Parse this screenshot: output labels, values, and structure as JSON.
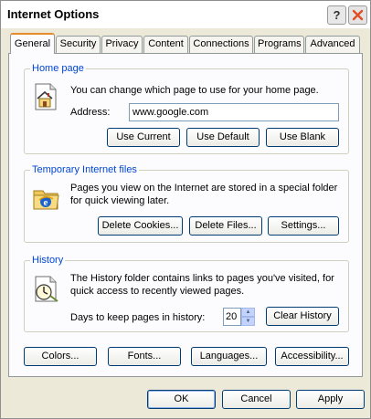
{
  "window": {
    "title": "Internet Options",
    "help_label": "?",
    "close_label": "✕"
  },
  "tabs": [
    {
      "label": "General",
      "active": true
    },
    {
      "label": "Security"
    },
    {
      "label": "Privacy"
    },
    {
      "label": "Content"
    },
    {
      "label": "Connections"
    },
    {
      "label": "Programs"
    },
    {
      "label": "Advanced"
    }
  ],
  "home_page": {
    "title": "Home page",
    "icon": "house-page-icon",
    "description": "You can change which page to use for your home page.",
    "address_label": "Address:",
    "address_value": "www.google.com",
    "buttons": [
      "Use Current",
      "Use Default",
      "Use Blank"
    ]
  },
  "temp_files": {
    "title": "Temporary Internet files",
    "icon": "ie-folder-icon",
    "description_line1": "Pages you view on the Internet are stored in a special folder",
    "description_line2": "for quick viewing later.",
    "buttons": [
      "Delete Cookies...",
      "Delete Files...",
      "Settings..."
    ]
  },
  "history": {
    "title": "History",
    "icon": "history-clock-icon",
    "description_line1": "The History folder contains links to pages you've visited, for",
    "description_line2": "quick access to recently viewed pages.",
    "days_label": "Days to keep pages in history:",
    "days_value": "20",
    "clear_button": "Clear History"
  },
  "bottom_buttons": [
    "Colors...",
    "Fonts...",
    "Languages...",
    "Accessibility..."
  ],
  "dialog_buttons": [
    "OK",
    "Cancel",
    "Apply"
  ],
  "colors": {
    "accent": "#0046d5",
    "tab_highlight": "#e68b2c",
    "close_button": "#e04e28"
  }
}
